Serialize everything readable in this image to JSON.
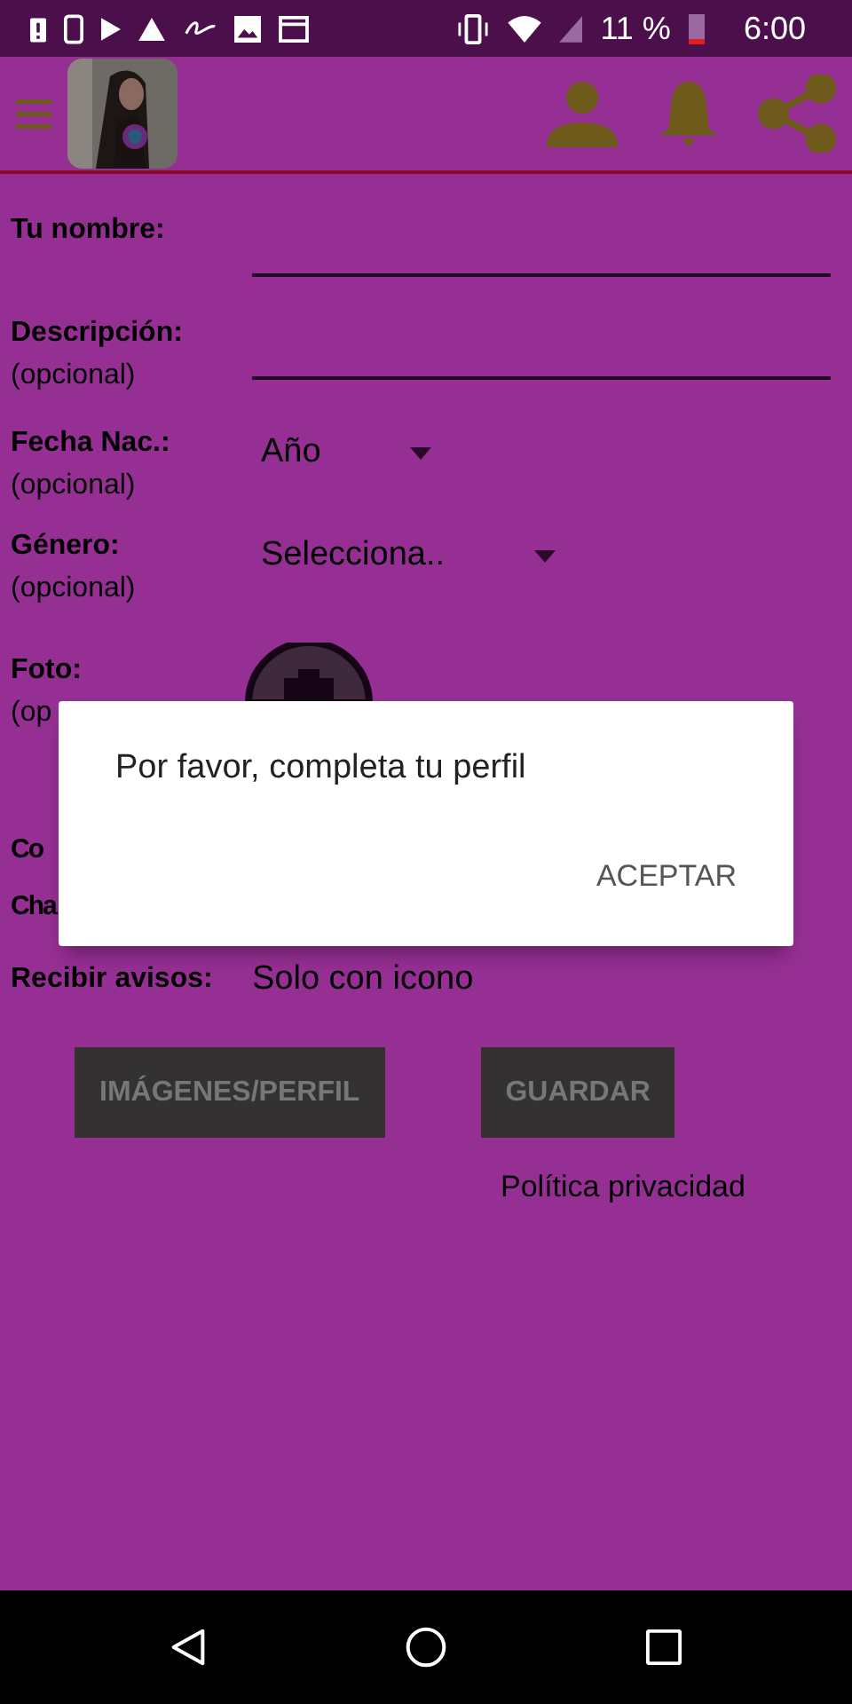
{
  "status_bar": {
    "battery": "11 %",
    "time": "6:00"
  },
  "form": {
    "fields": [
      {
        "kind": "text",
        "label": "Tu nombre:"
      },
      {
        "kind": "text",
        "label": "Descripción:",
        "note": "(opcional)"
      },
      {
        "kind": "select",
        "label": "Fecha Nac.:",
        "note": "(opcional)",
        "value": "Año"
      },
      {
        "kind": "select",
        "label": "Género:",
        "note": "(opcional)",
        "value": "Selecciona.."
      },
      {
        "label": "Foto:",
        "note": "(op"
      },
      {
        "kind": "covered",
        "label": "Co"
      },
      {
        "kind": "covered",
        "label": "Cha"
      },
      {
        "kind": "plain",
        "label": "Recibir avisos:",
        "value": "Solo con icono"
      }
    ],
    "buttons": [
      "IMÁGENES/PERFIL",
      "GUARDAR"
    ],
    "privacy_link": "Política privacidad"
  },
  "dialog": {
    "message": "Por favor, completa tu perfil",
    "button": "ACEPTAR"
  }
}
